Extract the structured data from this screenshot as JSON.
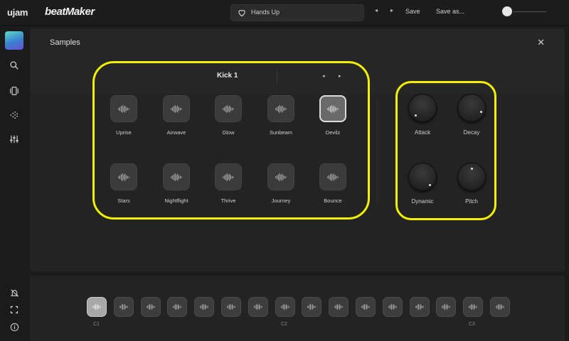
{
  "topbar": {
    "brand": "ujam",
    "product": "beatMaker",
    "preset_name": "Hands Up",
    "prev_arrow": "◂",
    "next_arrow": "▸",
    "save_label": "Save",
    "save_as_label": "Save as..."
  },
  "panel": {
    "title": "Samples",
    "close": "✕"
  },
  "kick": {
    "title": "Kick 1",
    "prev": "◂",
    "next": "▸"
  },
  "samples": [
    {
      "label": "Uprise",
      "selected": false
    },
    {
      "label": "Airwave",
      "selected": false
    },
    {
      "label": "Glow",
      "selected": false
    },
    {
      "label": "Sunbeam",
      "selected": false
    },
    {
      "label": "Devilz",
      "selected": true
    },
    {
      "label": "Stars",
      "selected": false
    },
    {
      "label": "Nightflight",
      "selected": false
    },
    {
      "label": "Thrive",
      "selected": false
    },
    {
      "label": "Journey",
      "selected": false
    },
    {
      "label": "Bounce",
      "selected": false
    }
  ],
  "knobs": [
    {
      "label": "Attack"
    },
    {
      "label": "Decay"
    },
    {
      "label": "Dynamic"
    },
    {
      "label": "Pitch"
    }
  ],
  "keys": {
    "count": 16,
    "selected_index": 0,
    "octave_labels": [
      "C1",
      "C2",
      "C3"
    ]
  },
  "colors": {
    "highlight": "#f0f000",
    "pad": "#3b3b3b",
    "pad_selected": "#6a6a6a",
    "background": "#1b1b1b"
  }
}
